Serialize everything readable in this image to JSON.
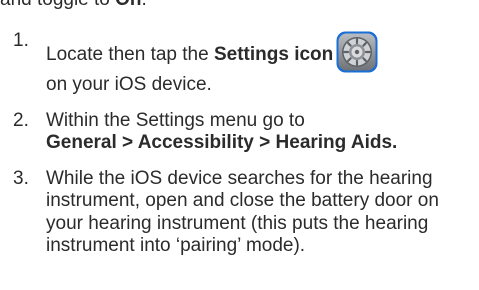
{
  "intro": {
    "prefix": "and toggle to ",
    "bold": "On",
    "suffix": "."
  },
  "steps": [
    {
      "number": "1.",
      "prefix": "Locate then tap the ",
      "bold": "Settings icon",
      "suffix": "on your iOS device.",
      "icon": "settings-gear-icon"
    },
    {
      "number": "2.",
      "prefix": "Within the Settings menu go to",
      "bold": "General > Accessibility > Hearing Aids."
    },
    {
      "number": "3.",
      "text": "While the iOS device searches for the hearing instrument, open and close the battery door on your hearing instrument (this puts the hearing instrument into ‘pairing’ mode)."
    }
  ],
  "colors": {
    "text": "#2b2b2b",
    "icon_ring": "#1a6fd6",
    "icon_face": "#8e9196"
  }
}
